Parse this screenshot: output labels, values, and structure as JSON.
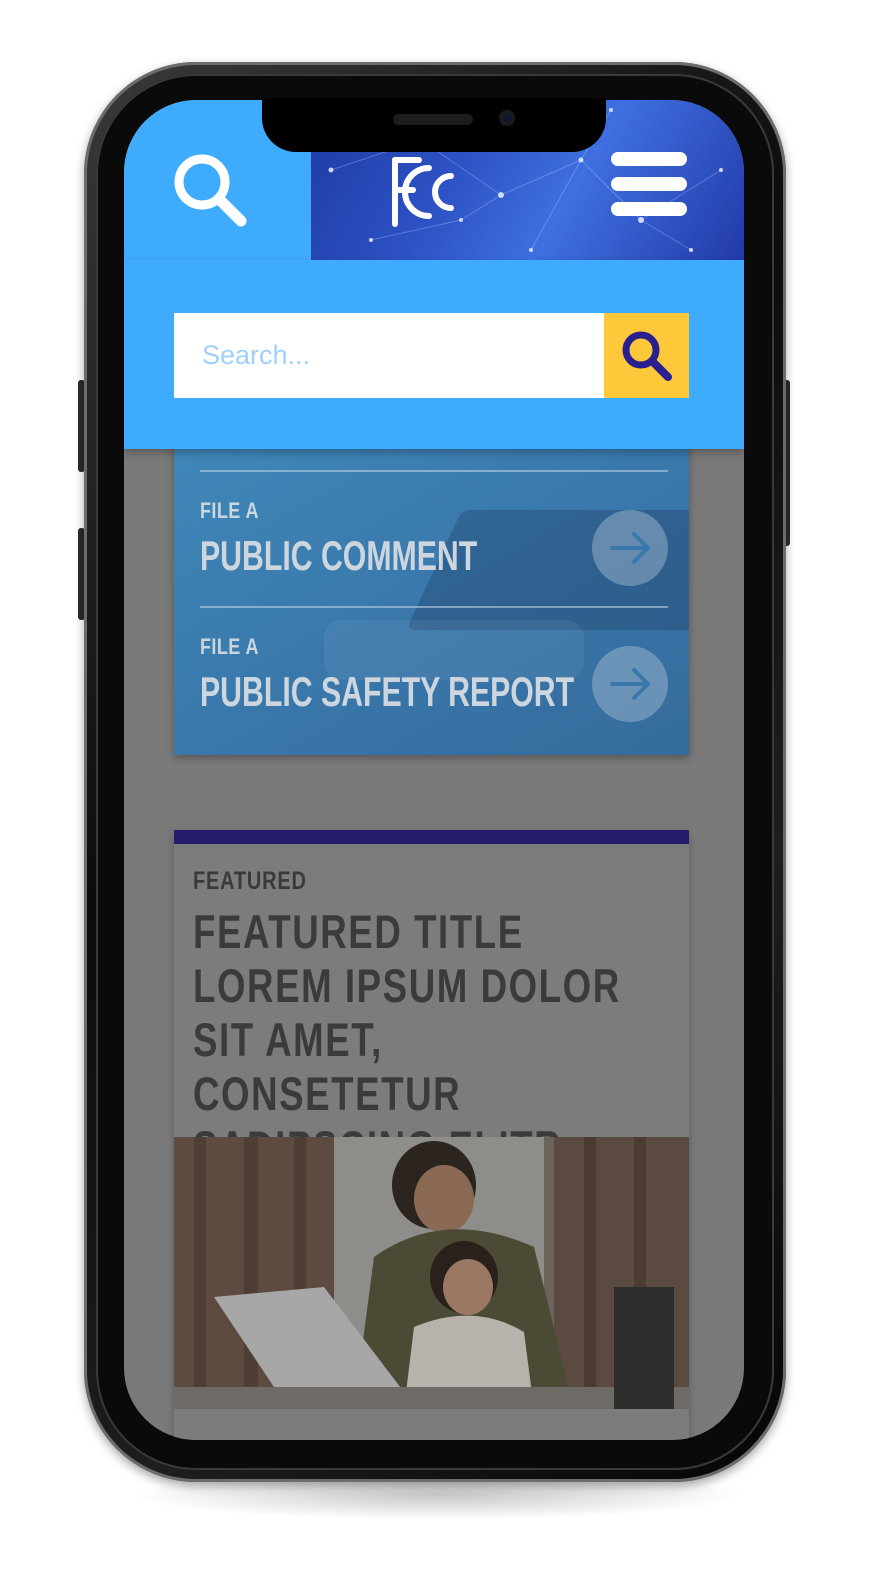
{
  "header": {
    "logo_text": "FCC",
    "colors": {
      "header_blue": "#3fabfd",
      "search_button": "#fdc93a",
      "search_icon": "#2a1f8f"
    }
  },
  "search": {
    "placeholder": "Search..."
  },
  "file_card": {
    "items": [
      {
        "prefix": "FILE A",
        "label": "PUBLIC COMMENT",
        "icon": "arrow-right-icon"
      },
      {
        "prefix": "FILE A",
        "label": "PUBLIC SAFETY REPORT",
        "icon": "arrow-right-icon"
      }
    ]
  },
  "featured": {
    "label": "FEATURED",
    "title": "Featured Title Lorem Ipsum dolor sit amet, consetetur sadipscing elitr",
    "accent_color": "#241d6e"
  },
  "icons": [
    "search-icon",
    "fcc-logo",
    "hamburger-menu-icon",
    "search-submit-icon",
    "arrow-right-icon"
  ]
}
